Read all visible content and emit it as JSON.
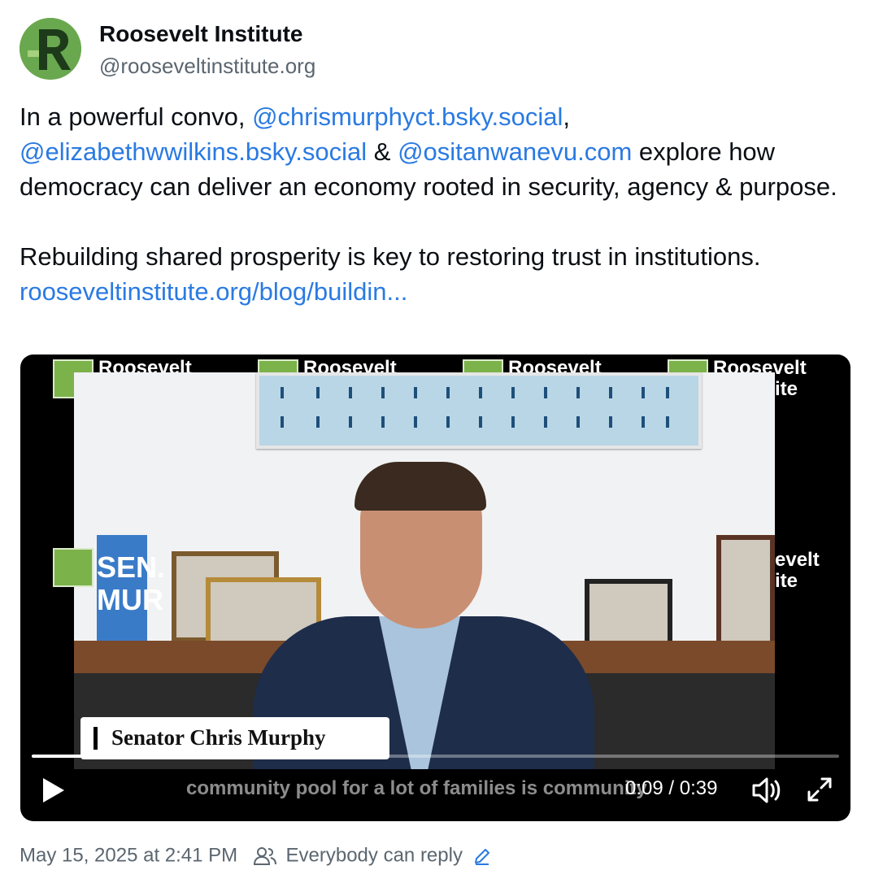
{
  "author": {
    "display_name": "Roosevelt Institute",
    "handle": "@rooseveltinstitute.org",
    "avatar_icon": "roosevelt-logo",
    "brand_color": "#6aa84f"
  },
  "post": {
    "p1_prefix": "In a powerful convo, ",
    "mention_1": "@chrismurphyct.bsky.social",
    "p1_sep1": ",",
    "mention_2": "@elizabethwwilkins.bsky.social",
    "p1_sep2": " & ",
    "mention_3": "@ositanwanevu.com",
    "p1_suffix": " explore how democracy can deliver an economy rooted in security, agency & purpose.",
    "p2_text": "Rebuilding shared prosperity is key to restoring trust in institutions. ",
    "link_text": "rooseveltinstitute.org/blog/buildin...",
    "link_color": "#2a7ae2"
  },
  "video": {
    "watermark_text_top": "Roosevelt",
    "watermark_text_mid_a": "evelt",
    "watermark_text_mid_b": "ite",
    "banner_text": "SEN. MUR",
    "lower_third_name": "Senator Chris Murphy",
    "caption": "community pool for a lot of families is community",
    "current_time": "0:09",
    "time_sep": " / ",
    "duration": "0:39",
    "progress_fraction": 0.23,
    "play_icon": "play-icon",
    "volume_icon": "volume-icon",
    "fullscreen_icon": "fullscreen-icon"
  },
  "footer": {
    "timestamp": "May 15, 2025 at 2:41 PM",
    "reply_setting": "Everybody can reply",
    "people_icon": "people-icon",
    "edit_icon": "pencil-icon"
  }
}
